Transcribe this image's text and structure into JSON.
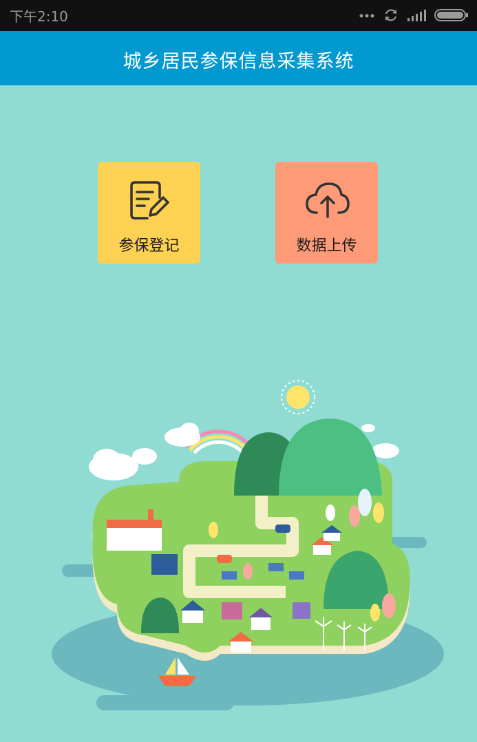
{
  "statusbar": {
    "time": "下午2:10",
    "icons": [
      "more-dots-icon",
      "sync-icon",
      "signal-icon",
      "battery-icon"
    ]
  },
  "header": {
    "title": "城乡居民参保信息采集系统"
  },
  "tiles": [
    {
      "label": "参保登记",
      "icon": "edit-document-icon",
      "color": "#fdd152"
    },
    {
      "label": "数据上传",
      "icon": "cloud-upload-icon",
      "color": "#fd9b79"
    }
  ],
  "colors": {
    "statusbar": "#111111",
    "header": "#0298d0",
    "background": "#90dcd3"
  }
}
